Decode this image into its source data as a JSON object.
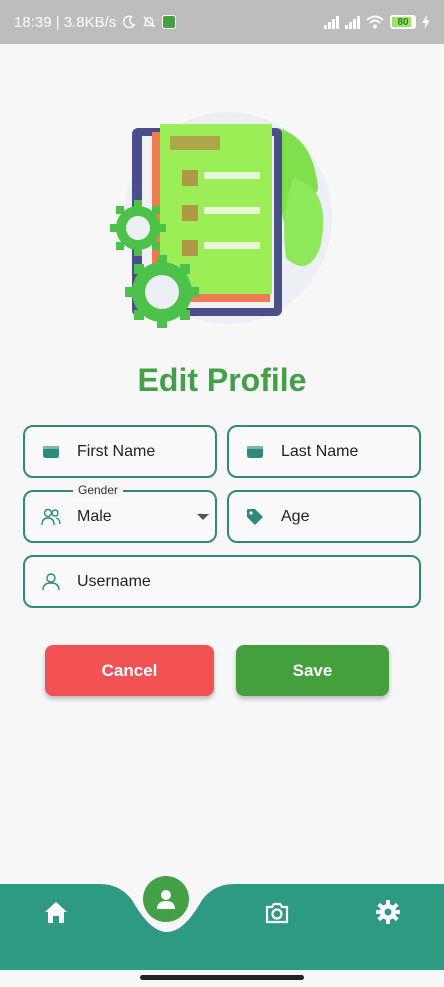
{
  "status_bar": {
    "time_speed": "18:39 | 3.8KB/s",
    "battery": "80"
  },
  "title": "Edit Profile",
  "form": {
    "first_name": {
      "placeholder": "First Name",
      "icon": "id-card-icon"
    },
    "last_name": {
      "placeholder": "Last Name",
      "icon": "id-card-icon"
    },
    "gender": {
      "label": "Gender",
      "value": "Male",
      "icon": "people-icon"
    },
    "age": {
      "placeholder": "Age",
      "icon": "tag-icon"
    },
    "username": {
      "placeholder": "Username",
      "icon": "person-icon"
    }
  },
  "buttons": {
    "cancel": "Cancel",
    "save": "Save"
  },
  "colors": {
    "accent": "#43a047",
    "border": "#2e8b79",
    "nav": "#2e9a82",
    "cancel": "#f25254",
    "save": "#43a03c"
  },
  "nav": {
    "items": [
      "home-icon",
      "profile-icon",
      "camera-icon",
      "settings-icon"
    ],
    "active": "profile-icon"
  }
}
